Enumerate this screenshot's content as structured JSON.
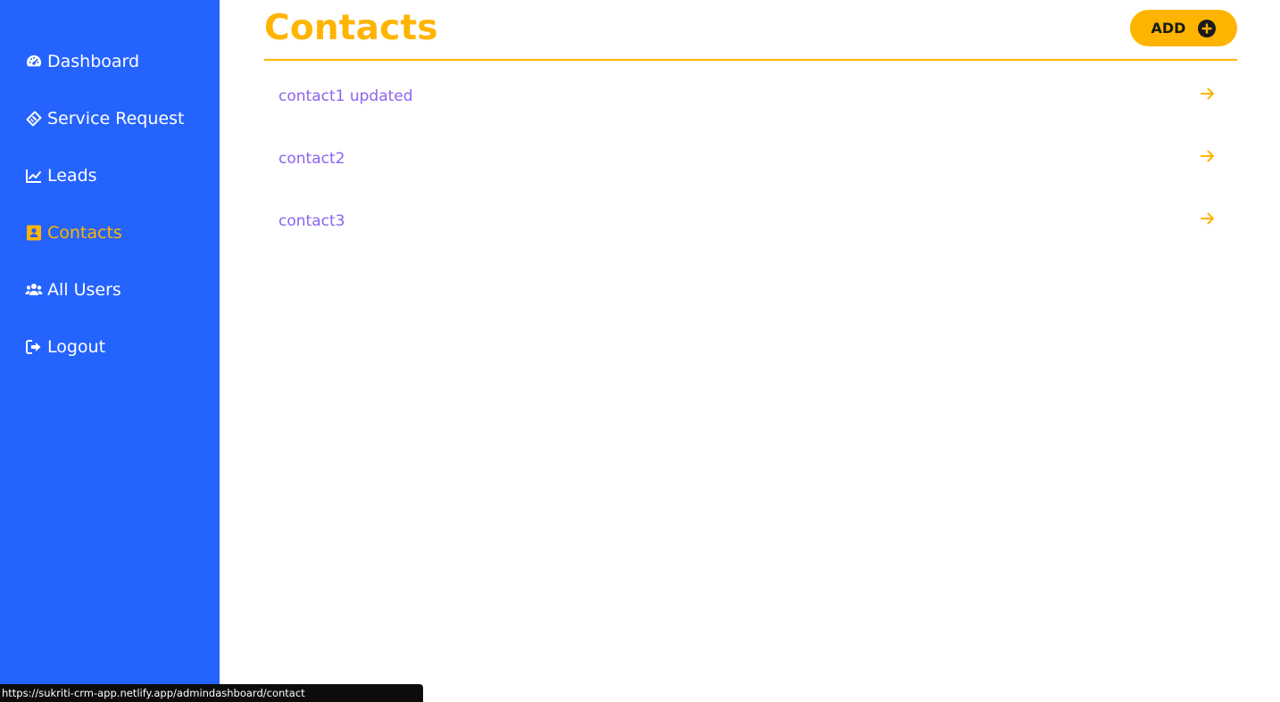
{
  "sidebar": {
    "items": [
      {
        "label": "Dashboard",
        "icon": "dashboard-gauge-icon",
        "active": false
      },
      {
        "label": "Service Request",
        "icon": "ticket-icon",
        "active": false
      },
      {
        "label": "Leads",
        "icon": "line-chart-icon",
        "active": false
      },
      {
        "label": "Contacts",
        "icon": "address-book-icon",
        "active": true
      },
      {
        "label": "All Users",
        "icon": "users-icon",
        "active": false
      },
      {
        "label": "Logout",
        "icon": "sign-out-icon",
        "active": false
      }
    ]
  },
  "header": {
    "title": "Contacts",
    "add_label": "ADD"
  },
  "contacts": [
    {
      "name": "contact1 updated"
    },
    {
      "name": "contact2"
    },
    {
      "name": "contact3"
    }
  ],
  "status_bar": {
    "url": "https://sukriti-crm-app.netlify.app/admindashboard/contact"
  },
  "colors": {
    "sidebar_bg": "#2563ff",
    "accent": "#ffb400",
    "link": "#8a63f0",
    "nav_text": "#ffffff"
  }
}
